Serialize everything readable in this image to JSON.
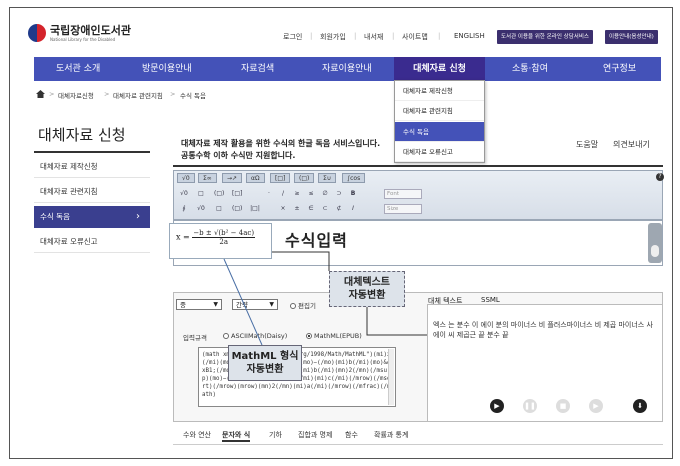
{
  "header": {
    "logo_name": "국립장애인도서관",
    "logo_sub": "National Library for the Disabled",
    "utility": [
      "로그인",
      "회원가입",
      "내서재",
      "사이트맵",
      "ENGLISH"
    ],
    "button_consult": "도서관 이용을 위한 온라인 상담서비스",
    "button_info": "이용안내(음성안내)"
  },
  "nav": {
    "items": [
      "도서관 소개",
      "방문이용안내",
      "자료검색",
      "자료이용안내",
      "대체자료 신청",
      "소통·참여",
      "연구정보"
    ]
  },
  "breadcrumb": [
    "대체자료신청",
    "대체자료 관련지침",
    "수식 독음"
  ],
  "dropdown": {
    "items": [
      "대체자료 제작신청",
      "대체자료 관련지침",
      "수식 독음",
      "대체자료 오류신고"
    ]
  },
  "sidebar": {
    "title": "대체자료 신청",
    "items": [
      "대체자료 제작신청",
      "대체자료 관련지침",
      "수식 독음",
      "대체자료 오류신고"
    ]
  },
  "content": {
    "intro_line1": "대체자료 제작 활용을 위한 수식의 한글 독음 서비스입니다.",
    "intro_line2": "공통수학 이하 수식만 지원합니다.",
    "help": "도움말",
    "feedback": "의견보내기"
  },
  "toolbar": {
    "tabs": [
      "√0",
      "Σ∞",
      "→↗",
      "αΩ",
      "[□]",
      "(□)",
      "Σ∪",
      "∫cos"
    ],
    "row1": [
      "√0",
      "□",
      "(□)",
      "[□]",
      "·",
      "/",
      "≥",
      "≤",
      "∅",
      "⊃",
      "B"
    ],
    "row2": [
      "∮",
      "√0",
      "□",
      "(□)",
      "|□|",
      "×",
      "±",
      "∈",
      "⊂",
      "⊄",
      "I"
    ],
    "font_select": "Font",
    "size_select": "Size",
    "help_icon": "?"
  },
  "editor": {
    "formula_lhs": "x =",
    "formula_num": "−b ± √(b² − 4ac)",
    "formula_den": "2a",
    "annotation": "수식입력"
  },
  "lower": {
    "select1": "중",
    "select2": "간략",
    "option_edit": "편집기",
    "input_label": "입력규격",
    "radio_ascii": "ASCIIMath(Daisy)",
    "radio_mathml": "MathML(EPUB)",
    "mathml_code": "(math xmlns=\"http://www.w3.org/1998/Math/MathML\")(mi)x(/mi)(mo)=(/mo)(mfrac)(mrow)(mo)−(/mo)(mi)b(/mi)(mo)&#xB1;(/mo)(msqrt)(mrow)(msup)(mi)b(/mi)(mn)2(/mn)(/msup)(mo)−(/mo)(mn)4(/mn)(mi)a(/mi)(mi)c(/mi)(/mrow)(/msqrt)(/mrow)(mrow)(mn)2(/mn)(mi)a(/mi)(/mrow)(/mfrac)(/math)",
    "tab_alt": "대체 텍스트",
    "tab_ssml": "SSML",
    "alt_text": "엑스 는 분수 이 에이 분의 마이너스 비 플러스마이너스 비 제곱 마이너스 사 에이 씨 제곱근 끝 분수 끝",
    "bottom_tabs": [
      "수와 연산",
      "문자와 식",
      "기하",
      "집합과 명제",
      "함수",
      "확률과 통계"
    ]
  },
  "callouts": {
    "alt_line1": "대체텍스트",
    "alt_line2": "자동변환",
    "mathml_line1": "MathML 형식",
    "mathml_line2": "자동변환"
  },
  "colors": {
    "nav": "#4452b8",
    "nav_active": "#3a2b8f",
    "sidebar_active": "#3a3f8f",
    "header_button": "#3b2f6e"
  }
}
